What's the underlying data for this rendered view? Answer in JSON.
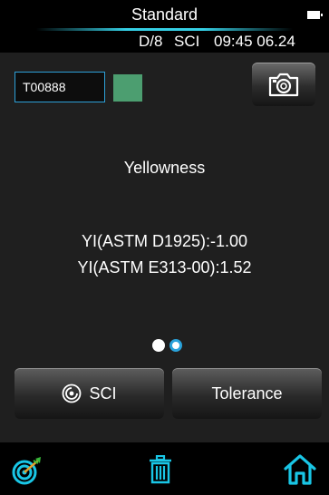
{
  "header": {
    "title": "Standard",
    "geometry": "D/8",
    "mode": "SCI",
    "clock": "09:45 06.24"
  },
  "sample": {
    "id": "T00888",
    "swatch_color": "#4c9e70"
  },
  "results": {
    "title": "Yellowness",
    "lines": [
      "YI(ASTM D1925):-1.00",
      "YI(ASTM E313-00):1.52"
    ]
  },
  "pagination": {
    "count": 2,
    "active": 2
  },
  "buttons": {
    "sci_label": "SCI",
    "tolerance_label": "Tolerance"
  },
  "icons": {
    "battery": "battery-icon",
    "camera": "camera-icon",
    "sci": "lens-icon",
    "target": "target-icon",
    "trash": "trash-icon",
    "home": "home-icon"
  },
  "colors": {
    "accent": "#2aa2da",
    "icon_cyan": "#19c6e6"
  }
}
